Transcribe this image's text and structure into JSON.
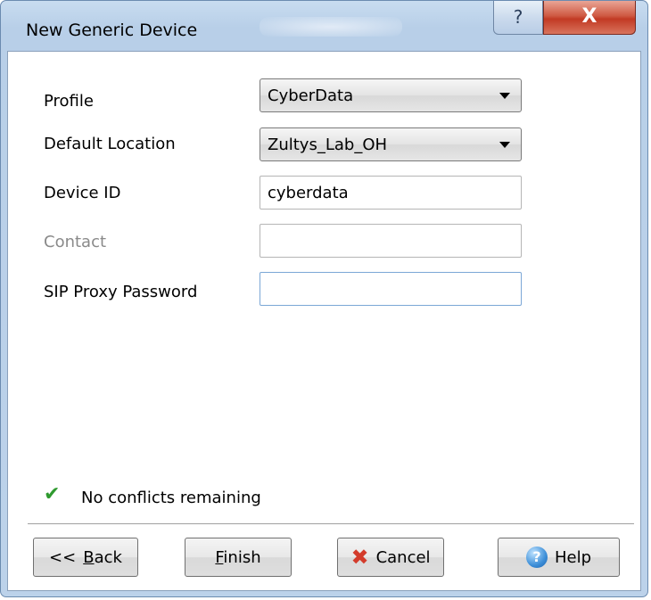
{
  "window": {
    "title": "New Generic Device",
    "help_glyph": "?",
    "close_glyph": "X"
  },
  "form": {
    "profile": {
      "label": "Profile",
      "value": "CyberData"
    },
    "default_location": {
      "label": "Default Location",
      "value": "Zultys_Lab_OH"
    },
    "device_id": {
      "label": "Device ID",
      "value": "cyberdata"
    },
    "contact": {
      "label": "Contact",
      "value": ""
    },
    "sip_proxy_password": {
      "label": "SIP Proxy Password",
      "value": ""
    }
  },
  "status": {
    "icon": "check-icon",
    "text": "No conflicts remaining",
    "color": "#2f9a2f"
  },
  "buttons": {
    "back_prefix": "<<",
    "back_mnemonic": "B",
    "back_rest": "ack",
    "finish_mnemonic": "F",
    "finish_rest": "inish",
    "cancel": "Cancel",
    "help": "Help"
  }
}
